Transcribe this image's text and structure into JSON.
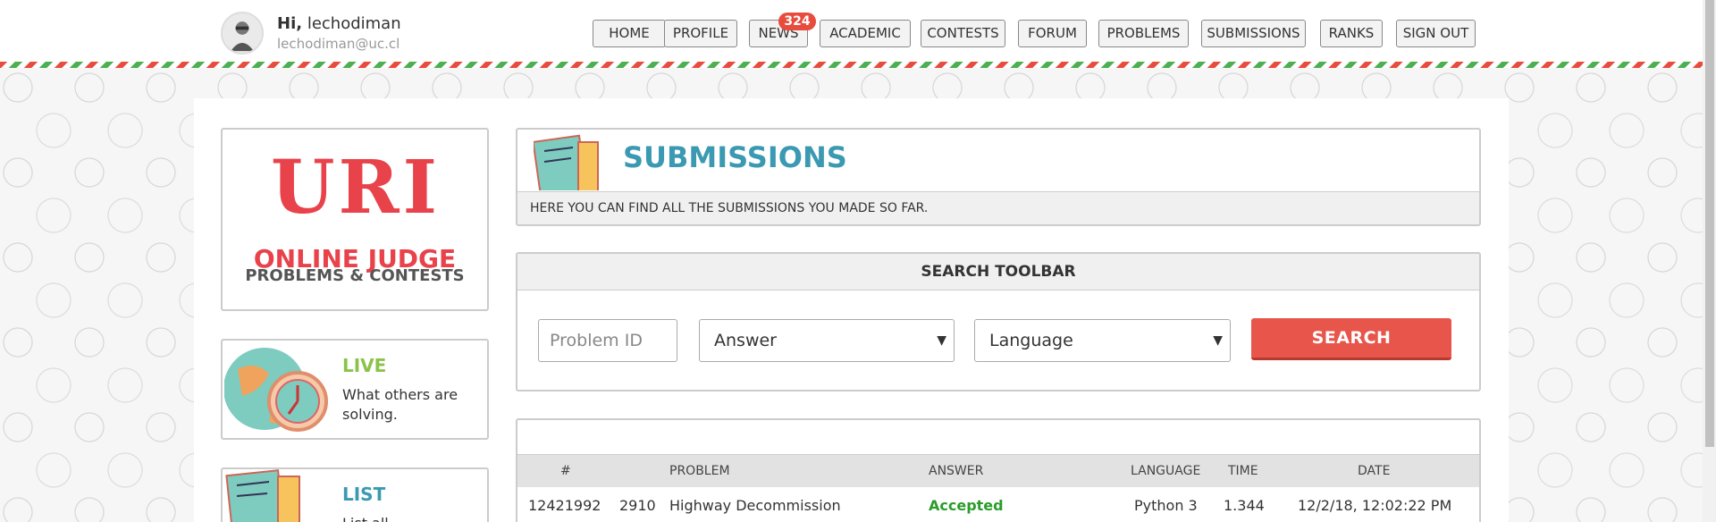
{
  "user": {
    "greeting": "Hi,",
    "name": "lechodiman",
    "email": "lechodiman@uc.cl"
  },
  "nav": {
    "items": [
      "HOME",
      "PROFILE",
      "NEWS",
      "ACADEMIC",
      "CONTESTS",
      "FORUM",
      "PROBLEMS",
      "SUBMISSIONS",
      "RANKS",
      "SIGN OUT"
    ],
    "news_badge": "324"
  },
  "logo": {
    "main": "URI",
    "line1": "ONLINE JUDGE",
    "line2": "PROBLEMS & CONTESTS"
  },
  "side": {
    "live": {
      "title": "LIVE",
      "desc": "What others are solving."
    },
    "list": {
      "title": "LIST",
      "desc": "List all"
    }
  },
  "submissions": {
    "title": "SUBMISSIONS",
    "subtitle": "HERE YOU CAN FIND ALL THE SUBMISSIONS YOU MADE SO FAR."
  },
  "toolbar": {
    "title": "SEARCH TOOLBAR",
    "problem_placeholder": "Problem ID",
    "answer": "Answer",
    "language": "Language",
    "search_label": "SEARCH"
  },
  "table": {
    "headers": [
      "#",
      "PROBLEM",
      "ANSWER",
      "LANGUAGE",
      "TIME",
      "DATE"
    ],
    "rows": [
      {
        "id": "12421992",
        "problem_id": "2910",
        "problem": "Highway Decommission",
        "answer": "Accepted",
        "language": "Python 3",
        "time": "1.344",
        "date": "12/2/18, 12:02:22 PM"
      }
    ]
  },
  "colors": {
    "accent": "#e8554a",
    "title_teal": "#3b9ab2",
    "live_green": "#8bc34a",
    "list_teal": "#3b9ab2",
    "accepted": "#2a9d2a"
  }
}
